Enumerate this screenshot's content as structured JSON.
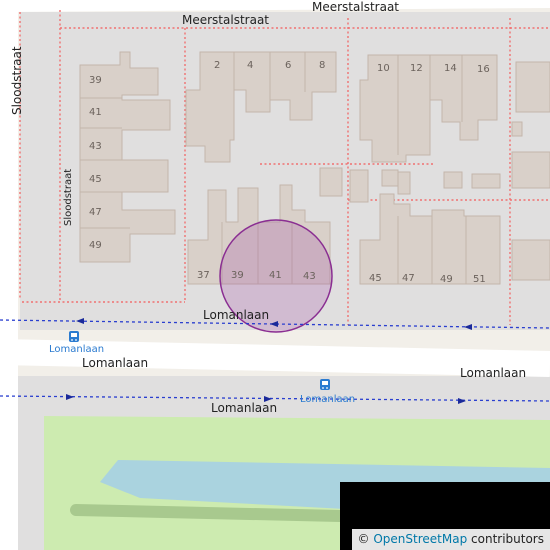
{
  "streets": {
    "meerstalstraat": "Meerstalstraat",
    "meerstalstraat_left": "Meerstalstraat",
    "sloodstraat_vertical": "Sloodstraat",
    "sloodstraat_inner": "Sloodstraat",
    "lomanlaan_left": "Lomanlaan",
    "lomanlaan_right": "Lomanlaan",
    "lomanlaan_path": "Lomanlaan",
    "lomanlaan_lower": "Lomanlaan"
  },
  "bus_stops": [
    "Lomanlaan",
    "Lomanlaan"
  ],
  "house_numbers": {
    "left_column": [
      "39",
      "41",
      "43",
      "45",
      "47",
      "49"
    ],
    "top_middle": [
      "2",
      "4",
      "6",
      "8"
    ],
    "top_right": [
      "10",
      "12",
      "14",
      "16"
    ],
    "bottom_middle": [
      "37",
      "39",
      "41",
      "43"
    ],
    "bottom_right": [
      "45",
      "47",
      "49",
      "51"
    ]
  },
  "attribution": {
    "symbol": "©",
    "link_text": "OpenStreetMap",
    "suffix": " contributors"
  },
  "colors": {
    "land": "#f2efe9",
    "residential": "#e0dfdf",
    "building": "#d9d0c9",
    "building_outline": "#c4b6ab",
    "road": "#ffffff",
    "park": "#cdebb0",
    "water": "#aad3df",
    "marker_fill": "#9c3ca0",
    "bus_route": "#2a3fcf",
    "property_line": "#f07070"
  }
}
